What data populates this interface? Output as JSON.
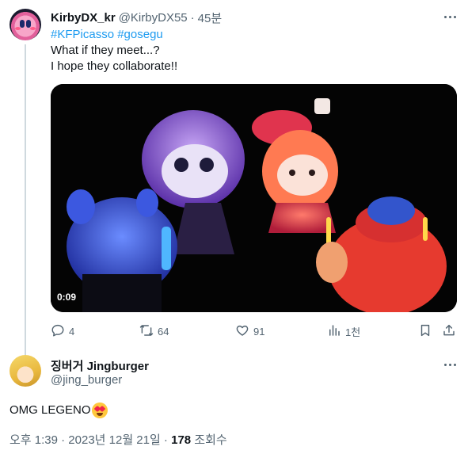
{
  "tweet": {
    "display_name": "KirbyDX_kr",
    "handle": "@KirbyDX55",
    "separator": "·",
    "time_ago": "45분",
    "hashtag1": "#KFPicasso",
    "hashtag2": "#gosegu",
    "line1": "What if they meet...?",
    "line2": "I hope they collaborate!!",
    "video_time": "0:09",
    "stats": {
      "replies": "4",
      "retweets": "64",
      "likes": "91",
      "views": "1천"
    }
  },
  "reply": {
    "display_name": "징버거 Jingburger",
    "handle": "@jing_burger",
    "text": "OMG LEGENO",
    "footer_time": "오후 1:39 · 2023년 12월 21일 · ",
    "footer_views": "178",
    "footer_views_label": " 조회수"
  },
  "icons": {
    "reply": "reply-icon",
    "retweet": "retweet-icon",
    "like": "heart-icon",
    "views": "analytics-icon",
    "bookmark": "bookmark-icon",
    "share": "share-icon",
    "more": "more-icon"
  },
  "colors": {
    "link": "#1d9bf0",
    "secondary": "#536471",
    "primary_text": "#0f1419"
  }
}
